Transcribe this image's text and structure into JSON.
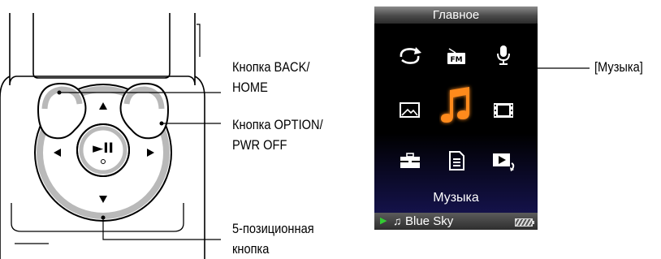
{
  "callouts": {
    "back_home": [
      "Кнопка BACK/",
      "HOME"
    ],
    "option_pwr": [
      "Кнопка OPTION/",
      "PWR OFF"
    ],
    "five_way": [
      "5-позиционная",
      "кнопка"
    ],
    "music": "[Музыка]"
  },
  "screen": {
    "header": "Главное",
    "selected_label": "Музыка",
    "now_playing": "Blue Sky",
    "icons": [
      "repeat-icon",
      "fm-radio-icon",
      "microphone-icon",
      "photo-icon",
      "music-note-icon",
      "video-icon",
      "toolbox-icon",
      "document-icon",
      "now-playing-icon"
    ],
    "selected_icon": "music-note-icon",
    "fm_text": "FM",
    "highlight_color": "#ff8a1e"
  },
  "buttons": {
    "play_pause_glyph": "►II"
  }
}
